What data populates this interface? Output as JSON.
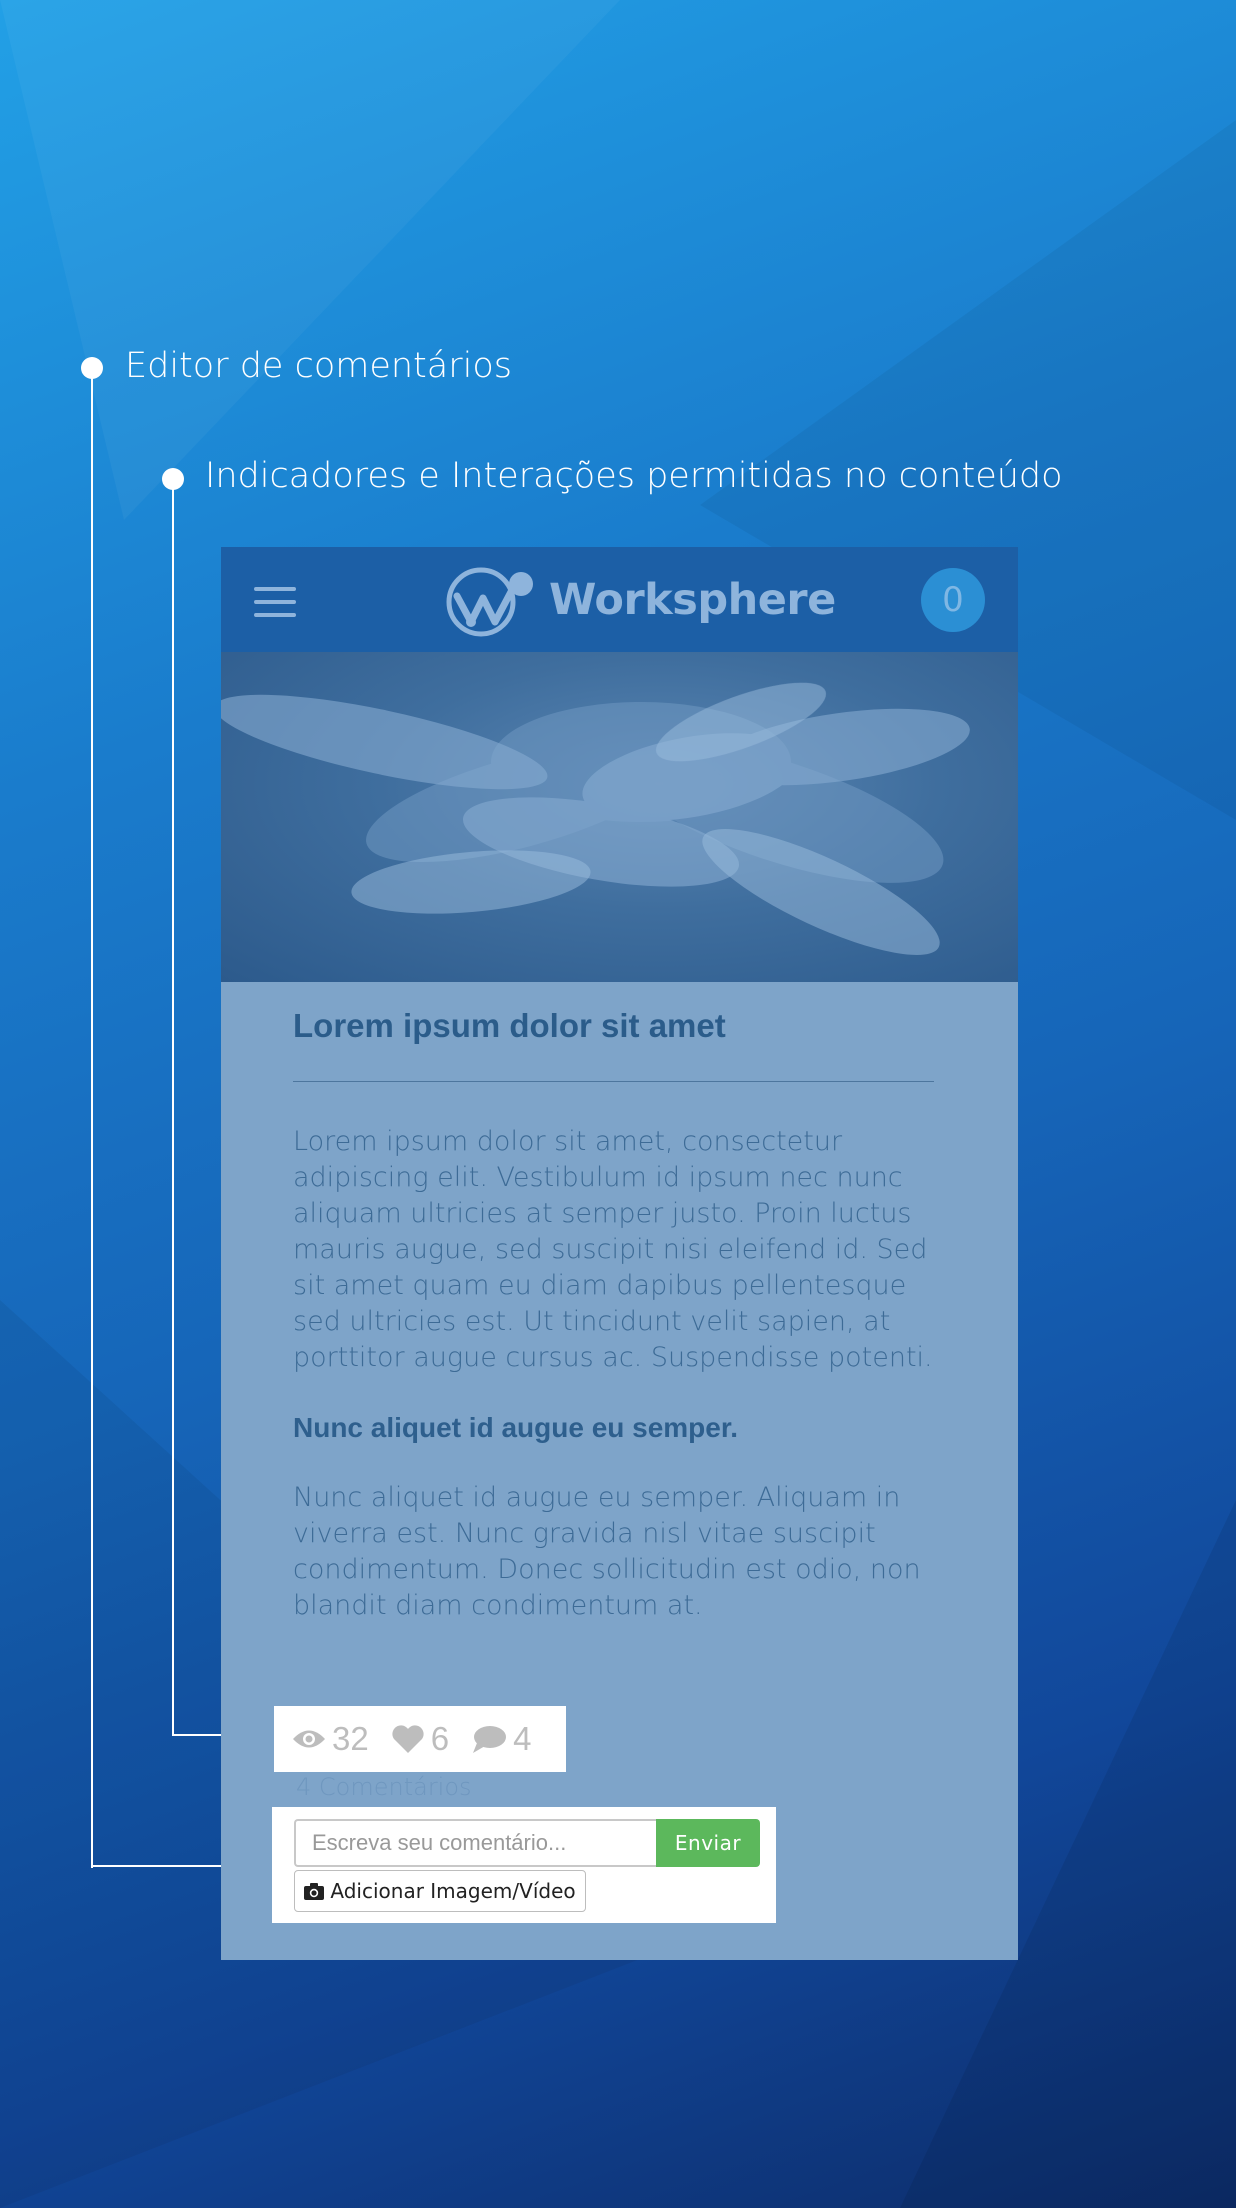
{
  "annotations": {
    "editor_label": "Editor de comentários",
    "indicators_label": "Indicadores e Interações permitidas no conteúdo"
  },
  "app": {
    "brand": "Worksphere",
    "notification_count": "0",
    "icons": {
      "menu": "hamburger-icon",
      "logo": "worksphere-logo-icon"
    }
  },
  "article": {
    "title": "Lorem ipsum dolor sit amet",
    "paragraph_1": "Lorem ipsum dolor sit amet, consectetur adipiscing elit. Vestibulum id ipsum nec nunc aliquam ultricies at semper justo. Proin luctus mauris augue, sed suscipit nisi eleifend id. Sed sit amet quam eu diam dapibus pellentesque sed ultricies est. Ut tincidunt velit sapien, at porttitor augue cursus ac. Suspendisse potenti.",
    "subheading": "Nunc aliquet id augue eu semper.",
    "paragraph_2": "Nunc aliquet id augue eu semper. Aliquam in viverra est. Nunc gravida nisl vitae suscipit condimentum. Donec sollicitudin est odio, non blandit diam condimentum at."
  },
  "indicators": {
    "views": "32",
    "likes": "6",
    "comments": "4",
    "icons": {
      "views": "eye-icon",
      "likes": "heart-icon",
      "comments": "comment-icon"
    }
  },
  "comments": {
    "count_label": "4 Comentários",
    "input_placeholder": "Escreva seu comentário...",
    "send_label": "Enviar",
    "media_label": "Adicionar Imagem/Vídeo",
    "media_icon": "camera-icon",
    "send_color": "#5cb85c"
  }
}
